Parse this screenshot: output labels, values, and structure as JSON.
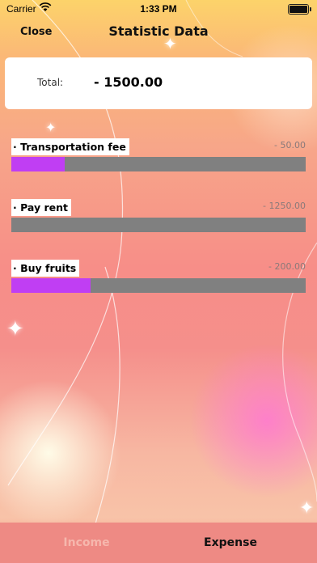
{
  "status": {
    "carrier": "Carrier",
    "time": "1:33 PM"
  },
  "nav": {
    "close_label": "Close",
    "title": "Statistic Data"
  },
  "total": {
    "label": "Total:",
    "value": "- 1500.00"
  },
  "items": [
    {
      "label": "· Transportation fee",
      "value": "- 50.00",
      "fraction": 0.18,
      "color": "#c03ef3"
    },
    {
      "label": "· Pay rent",
      "value": "- 1250.00",
      "fraction": 0.0,
      "color": "#c03ef3"
    },
    {
      "label": "· Buy fruits",
      "value": "- 200.00",
      "fraction": 0.27,
      "color": "#c03ef3"
    }
  ],
  "tabs": {
    "income": "Income",
    "expense": "Expense",
    "selected": "Expense"
  },
  "colors": {
    "bar_track": "#808080",
    "bar_fill": "#c03ef3",
    "tab_bar": "#ee8a84"
  }
}
